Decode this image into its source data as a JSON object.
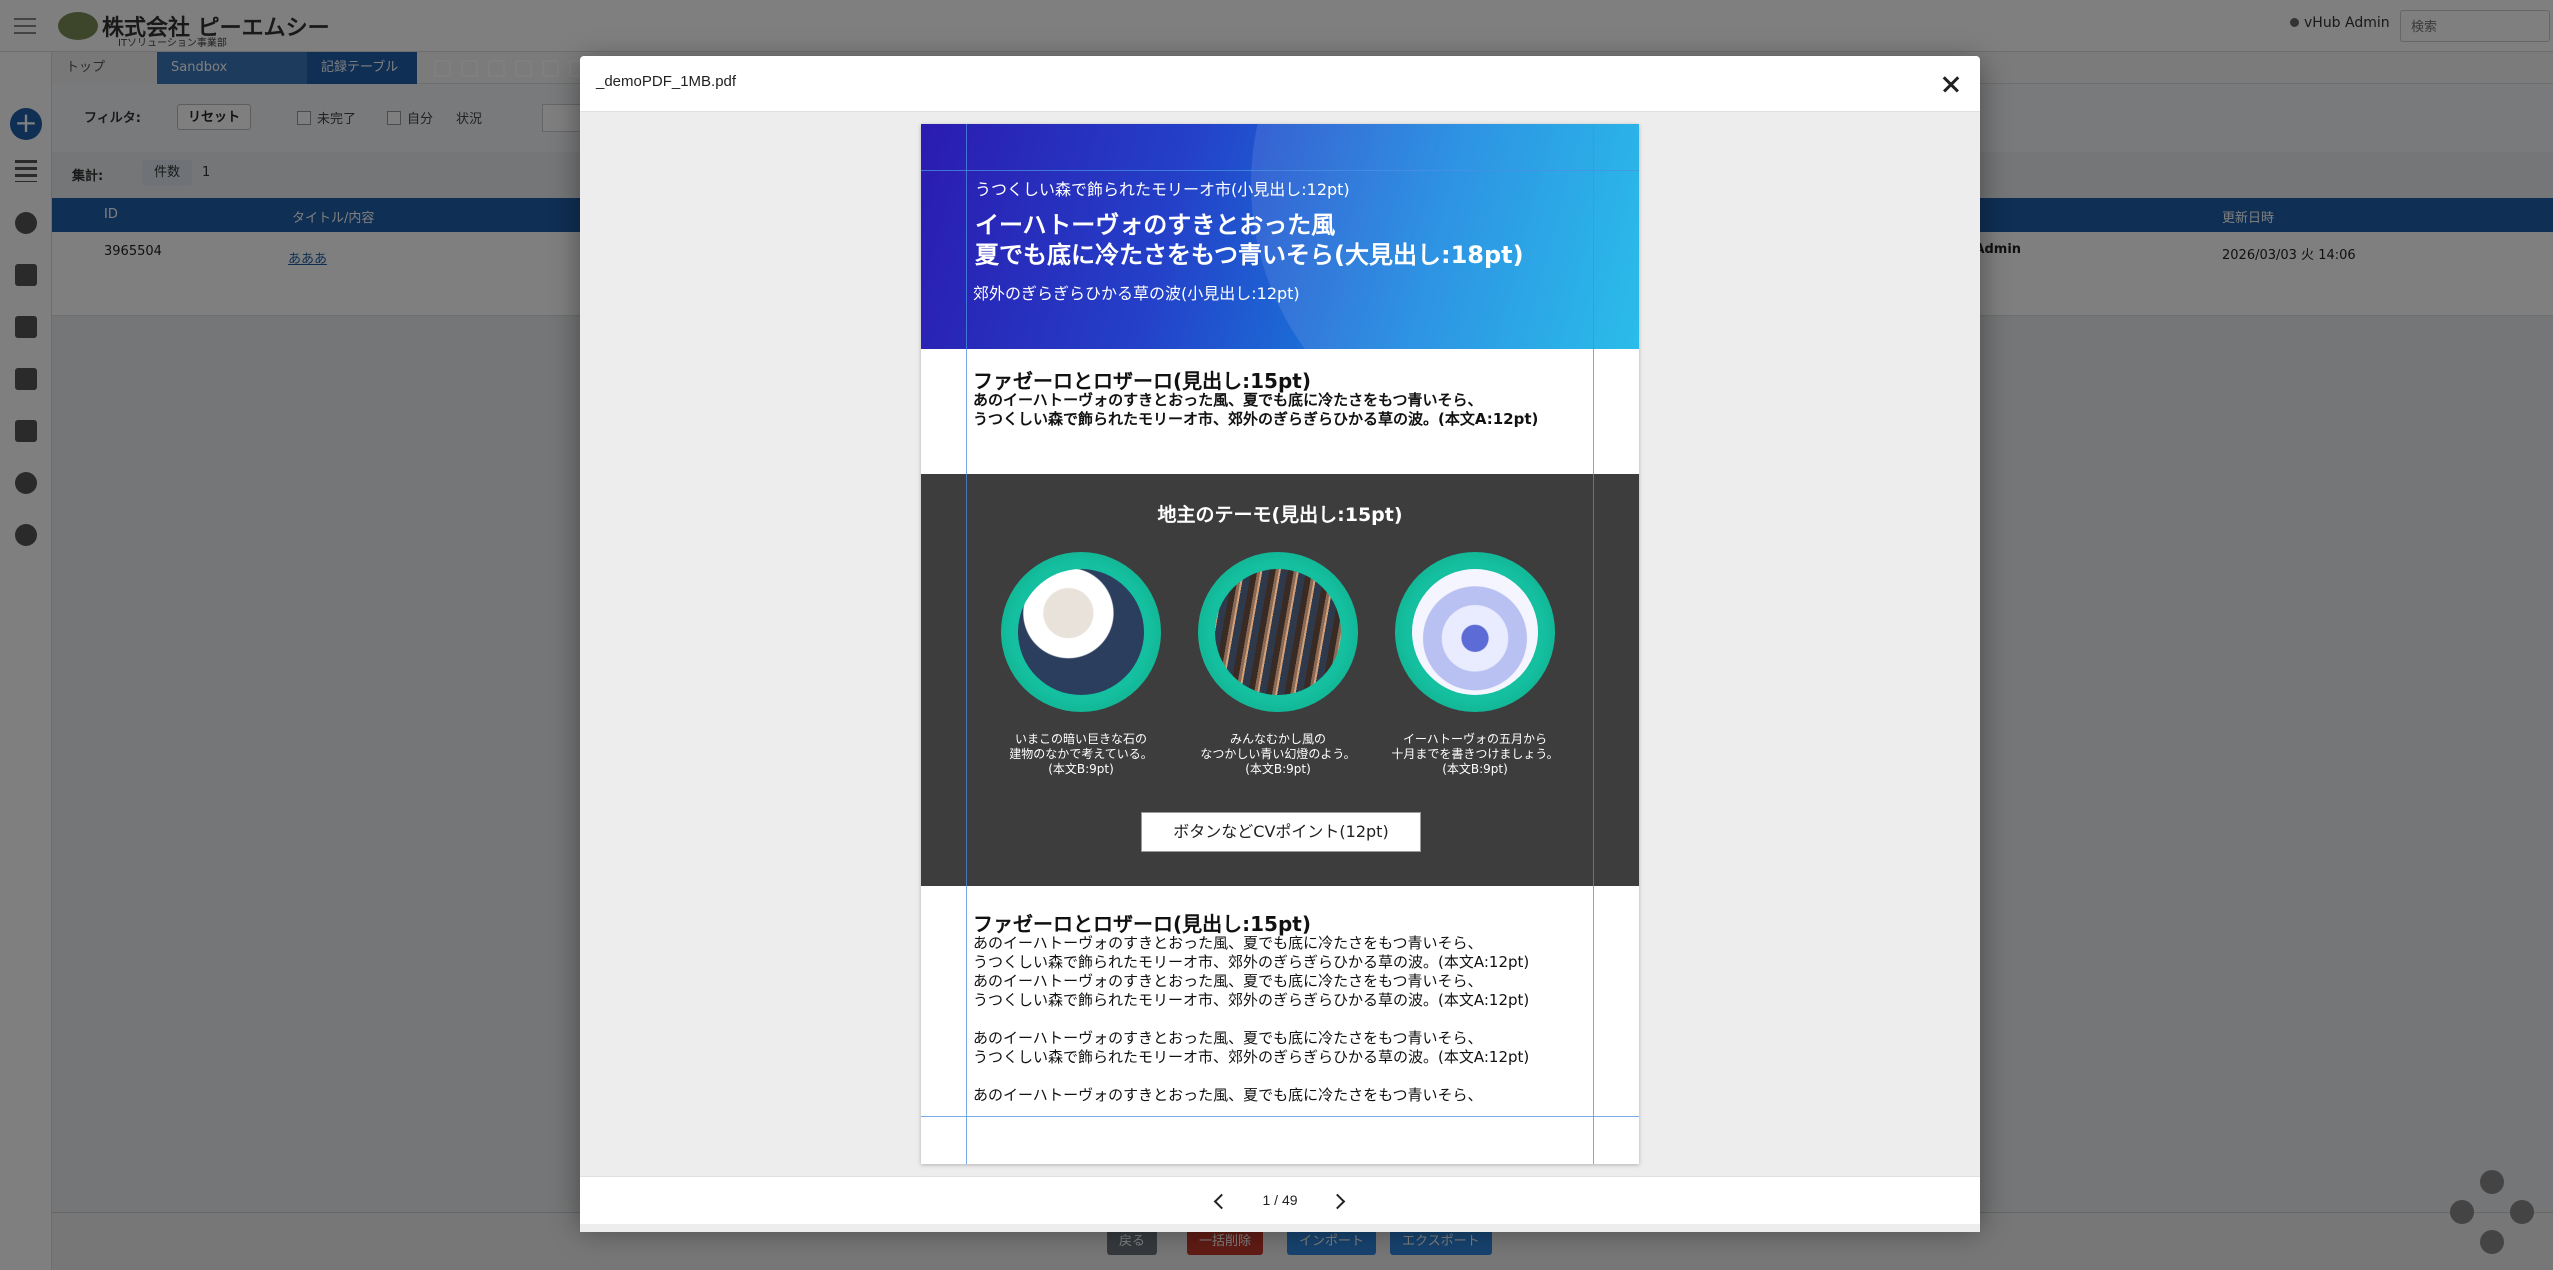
{
  "header": {
    "logo_text": "株式会社 ピーエムシー",
    "logo_sub": "ITソリューション事業部",
    "user_name": "vHub Admin",
    "search_placeholder": "検索"
  },
  "breadcrumb": {
    "home": "トップ",
    "sandbox": "Sandbox",
    "table": "記録テーブル"
  },
  "filter": {
    "label": "フィルタ:",
    "reset": "リセット",
    "incomplete": "未完了",
    "mine": "自分",
    "status": "状況"
  },
  "aggregate": {
    "label": "集計:",
    "chip": "件数",
    "count": "1"
  },
  "grid": {
    "columns": {
      "id": "ID",
      "title": "タイトル/内容",
      "updated": "更新日時"
    },
    "row": {
      "id": "3965504",
      "title": "あああ",
      "owner": "vHub Admin",
      "updated": "2026/03/03 火 14:06"
    }
  },
  "footer_buttons": {
    "back": "戻る",
    "delete": "一括削除",
    "import": "インポート",
    "export": "エクスポート"
  },
  "modal": {
    "title": "_demoPDF_1MB.pdf",
    "page_indicator": "1 / 49"
  },
  "pdf": {
    "hero": {
      "sub1": "うつくしい森で飾られたモリーオ市(小見出し:12pt)",
      "title_line1": "イーハトーヴォのすきとおった風",
      "title_line2": "夏でも底に冷たさをもつ青いそら(大見出し:18pt)",
      "sub2": "郊外のぎらぎらひかる草の波(小見出し:12pt)"
    },
    "section1": {
      "heading": "ファゼーロとロザーロ(見出し:15pt)",
      "body_line1": "あのイーハトーヴォのすきとおった風、夏でも底に冷たさをもつ青いそら、",
      "body_line2": "うつくしい森で飾られたモリーオ市、郊外のぎらぎらひかる草の波。(本文A:12pt)"
    },
    "dark": {
      "title": "地主のテーモ(見出し:15pt)",
      "items": [
        {
          "line1": "いまこの暗い巨きな石の",
          "line2": "建物のなかで考えている。",
          "line3": "(本文B:9pt)"
        },
        {
          "line1": "みんなむかし風の",
          "line2": "なつかしい青い幻燈のよう。",
          "line3": "(本文B:9pt)"
        },
        {
          "line1": "イーハトーヴォの五月から",
          "line2": "十月までを書きつけましょう。",
          "line3": "(本文B:9pt)"
        }
      ],
      "cv_button": "ボタンなどCVポイント(12pt)"
    },
    "section3": {
      "heading": "ファゼーロとロザーロ(見出し:15pt)",
      "lines": [
        "あのイーハトーヴォのすきとおった風、夏でも底に冷たさをもつ青いそら、",
        "うつくしい森で飾られたモリーオ市、郊外のぎらぎらひかる草の波。(本文A:12pt)",
        "あのイーハトーヴォのすきとおった風、夏でも底に冷たさをもつ青いそら、",
        "うつくしい森で飾られたモリーオ市、郊外のぎらぎらひかる草の波。(本文A:12pt)",
        "あのイーハトーヴォのすきとおった風、夏でも底に冷たさをもつ青いそら、",
        "うつくしい森で飾られたモリーオ市、郊外のぎらぎらひかる草の波。(本文A:12pt)",
        "あのイーハトーヴォのすきとおった風、夏でも底に冷たさをもつ青いそら、"
      ]
    }
  }
}
